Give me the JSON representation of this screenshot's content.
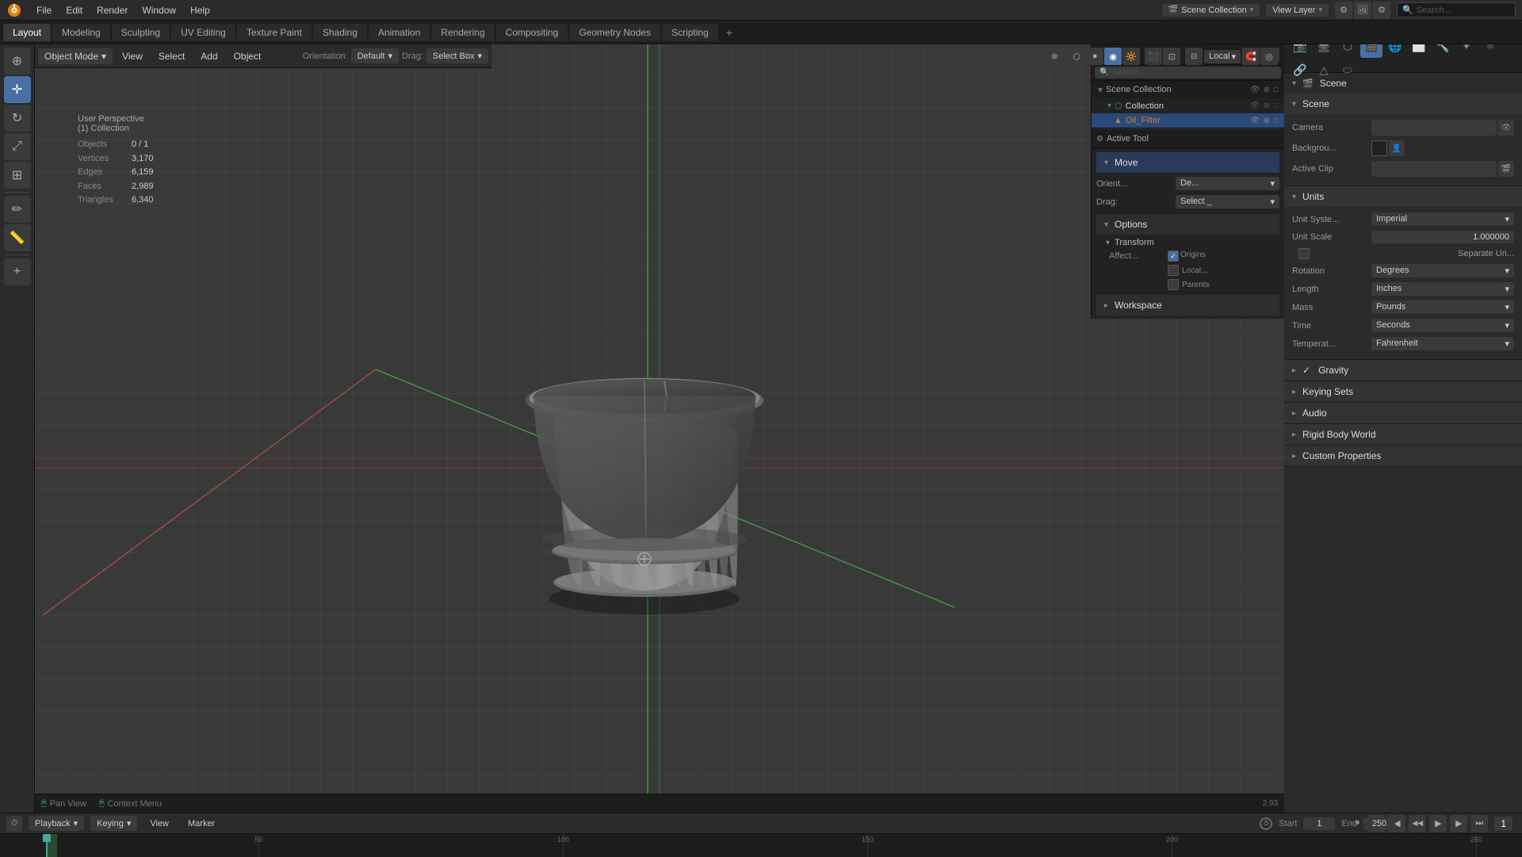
{
  "app": {
    "title": "Blender"
  },
  "top_menu": {
    "items": [
      "Blender",
      "File",
      "Edit",
      "Render",
      "Window",
      "Help"
    ]
  },
  "workspace_tabs": {
    "tabs": [
      "Layout",
      "Modeling",
      "Sculpting",
      "UV Editing",
      "Texture Paint",
      "Shading",
      "Animation",
      "Rendering",
      "Compositing",
      "Geometry Nodes",
      "Scripting"
    ],
    "active": "Layout",
    "add_label": "+"
  },
  "header": {
    "mode": "Object Mode",
    "view_label": "View",
    "select_label": "Select",
    "add_label": "Add",
    "object_label": "Object",
    "orientation": "Default",
    "orientation_prefix": "Orientation:",
    "drag_label": "Drag:",
    "select_box": "Select Box",
    "local_label": "Local"
  },
  "viewport": {
    "label": "User Perspective",
    "collection": "(1) Collection",
    "stats": {
      "objects_label": "Objects",
      "objects_val": "0 / 1",
      "vertices_label": "Vertices",
      "vertices_val": "3,170",
      "edges_label": "Edges",
      "edges_val": "6,159",
      "faces_label": "Faces",
      "faces_val": "2,989",
      "triangles_label": "Triangles",
      "triangles_val": "6,340"
    }
  },
  "outliner": {
    "title": "Scene Collection",
    "search_placeholder": "Search...",
    "items": [
      {
        "name": "Scene Collection",
        "type": "collection",
        "depth": 0
      },
      {
        "name": "Collection",
        "type": "collection",
        "depth": 1
      },
      {
        "name": "Oil_Filter",
        "type": "mesh",
        "depth": 2
      }
    ]
  },
  "active_tool": {
    "title": "Active Tool",
    "tool_name": "Move",
    "orient_label": "Orient...",
    "orient_val": "De...",
    "drag_label": "Drag:",
    "drag_val": "Select _",
    "options_label": "Options",
    "transform_label": "Transform",
    "affect_label": "Affect...",
    "origins_label": "Origins",
    "locat_label": "Locat...",
    "parents_label": "Parents",
    "workspace_label": "Workspace"
  },
  "properties": {
    "scene_label": "Scene",
    "sections": {
      "scene": {
        "header": "Scene",
        "camera_label": "Camera",
        "background_label": "Backgrou...",
        "active_clip_label": "Active Clip"
      },
      "units": {
        "header": "Units",
        "unit_system_label": "Unit Syste...",
        "unit_system_val": "Imperial",
        "unit_scale_label": "Unit Scale",
        "unit_scale_val": "1.000000",
        "separate_units_label": "Separate Un...",
        "rotation_label": "Rotation",
        "rotation_val": "Degrees",
        "length_label": "Length",
        "length_val": "Inches",
        "mass_label": "Mass",
        "mass_val": "Pounds",
        "time_label": "Time",
        "time_val": "Seconds",
        "temperature_label": "Temperat...",
        "temperature_val": "Fahrenheit"
      },
      "gravity": {
        "header": "Gravity"
      },
      "keying_sets": {
        "header": "Keying Sets"
      },
      "audio": {
        "header": "Audio"
      },
      "rigid_body_world": {
        "header": "Rigid Body World"
      },
      "custom_properties": {
        "header": "Custom Properties"
      }
    }
  },
  "timeline": {
    "playback_label": "Playback",
    "keying_label": "Keying",
    "view_label": "View",
    "marker_label": "Marker",
    "start_label": "Start",
    "start_val": "1",
    "end_label": "End",
    "end_val": "250",
    "current_frame": "1",
    "markers": [
      1,
      50,
      100,
      150,
      200,
      250
    ],
    "fps": "2.93"
  },
  "status_bar": {
    "pan_view": "Pan View",
    "context_menu": "Context Menu"
  },
  "icons": {
    "collapse_open": "▾",
    "collapse_closed": "▸",
    "checkbox_checked": "✓",
    "play": "▶",
    "pause": "⏸",
    "step_forward": "⏭",
    "step_backward": "⏮",
    "jump_start": "⏮",
    "jump_end": "⏭"
  }
}
